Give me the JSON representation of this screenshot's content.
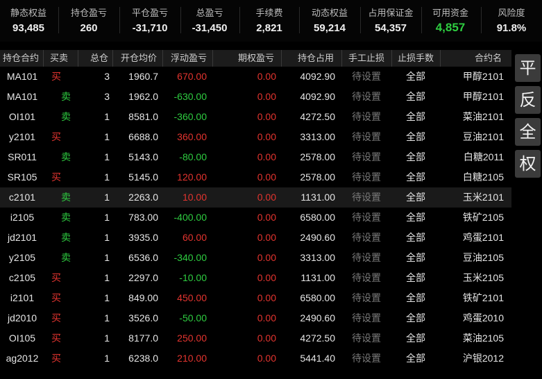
{
  "summary": [
    {
      "label": "静态权益",
      "value": "93,485"
    },
    {
      "label": "持仓盈亏",
      "value": "260"
    },
    {
      "label": "平仓盈亏",
      "value": "-31,710"
    },
    {
      "label": "总盈亏",
      "value": "-31,450"
    },
    {
      "label": "手续费",
      "value": "2,821"
    },
    {
      "label": "动态权益",
      "value": "59,214"
    },
    {
      "label": "占用保证金",
      "value": "54,357"
    },
    {
      "label": "可用资金",
      "value": "4,857"
    },
    {
      "label": "风险度",
      "value": "91.8%"
    }
  ],
  "columns": [
    "持仓合约",
    "买卖",
    "总仓",
    "开仓均价",
    "浮动盈亏",
    "期权盈亏",
    "持仓占用",
    "手工止损",
    "止损手数",
    "合约名"
  ],
  "rows": [
    {
      "contract": "MA101",
      "side": "买",
      "qty": "3",
      "avg": "1960.7",
      "pnl": "670.00",
      "opt": "0.00",
      "margin": "4092.90",
      "stop": "待设置",
      "stop_qty": "全部",
      "name": "甲醇2101"
    },
    {
      "contract": "MA101",
      "side": "卖",
      "qty": "3",
      "avg": "1962.0",
      "pnl": "-630.00",
      "opt": "0.00",
      "margin": "4092.90",
      "stop": "待设置",
      "stop_qty": "全部",
      "name": "甲醇2101"
    },
    {
      "contract": "OI101",
      "side": "卖",
      "qty": "1",
      "avg": "8581.0",
      "pnl": "-360.00",
      "opt": "0.00",
      "margin": "4272.50",
      "stop": "待设置",
      "stop_qty": "全部",
      "name": "菜油2101"
    },
    {
      "contract": "y2101",
      "side": "买",
      "qty": "1",
      "avg": "6688.0",
      "pnl": "360.00",
      "opt": "0.00",
      "margin": "3313.00",
      "stop": "待设置",
      "stop_qty": "全部",
      "name": "豆油2101"
    },
    {
      "contract": "SR011",
      "side": "卖",
      "qty": "1",
      "avg": "5143.0",
      "pnl": "-80.00",
      "opt": "0.00",
      "margin": "2578.00",
      "stop": "待设置",
      "stop_qty": "全部",
      "name": "白糖2011"
    },
    {
      "contract": "SR105",
      "side": "买",
      "qty": "1",
      "avg": "5145.0",
      "pnl": "120.00",
      "opt": "0.00",
      "margin": "2578.00",
      "stop": "待设置",
      "stop_qty": "全部",
      "name": "白糖2105"
    },
    {
      "contract": "c2101",
      "side": "卖",
      "qty": "1",
      "avg": "2263.0",
      "pnl": "10.00",
      "opt": "0.00",
      "margin": "1131.00",
      "stop": "待设置",
      "stop_qty": "全部",
      "name": "玉米2101"
    },
    {
      "contract": "i2105",
      "side": "卖",
      "qty": "1",
      "avg": "783.00",
      "pnl": "-400.00",
      "opt": "0.00",
      "margin": "6580.00",
      "stop": "待设置",
      "stop_qty": "全部",
      "name": "铁矿2105"
    },
    {
      "contract": "jd2101",
      "side": "卖",
      "qty": "1",
      "avg": "3935.0",
      "pnl": "60.00",
      "opt": "0.00",
      "margin": "2490.60",
      "stop": "待设置",
      "stop_qty": "全部",
      "name": "鸡蛋2101"
    },
    {
      "contract": "y2105",
      "side": "卖",
      "qty": "1",
      "avg": "6536.0",
      "pnl": "-340.00",
      "opt": "0.00",
      "margin": "3313.00",
      "stop": "待设置",
      "stop_qty": "全部",
      "name": "豆油2105"
    },
    {
      "contract": "c2105",
      "side": "买",
      "qty": "1",
      "avg": "2297.0",
      "pnl": "-10.00",
      "opt": "0.00",
      "margin": "1131.00",
      "stop": "待设置",
      "stop_qty": "全部",
      "name": "玉米2105"
    },
    {
      "contract": "i2101",
      "side": "买",
      "qty": "1",
      "avg": "849.00",
      "pnl": "450.00",
      "opt": "0.00",
      "margin": "6580.00",
      "stop": "待设置",
      "stop_qty": "全部",
      "name": "铁矿2101"
    },
    {
      "contract": "jd2010",
      "side": "买",
      "qty": "1",
      "avg": "3526.0",
      "pnl": "-50.00",
      "opt": "0.00",
      "margin": "2490.60",
      "stop": "待设置",
      "stop_qty": "全部",
      "name": "鸡蛋2010"
    },
    {
      "contract": "OI105",
      "side": "买",
      "qty": "1",
      "avg": "8177.0",
      "pnl": "250.00",
      "opt": "0.00",
      "margin": "4272.50",
      "stop": "待设置",
      "stop_qty": "全部",
      "name": "菜油2105"
    },
    {
      "contract": "ag2012",
      "side": "买",
      "qty": "1",
      "avg": "6238.0",
      "pnl": "210.00",
      "opt": "0.00",
      "margin": "5441.40",
      "stop": "待设置",
      "stop_qty": "全部",
      "name": "沪银2012"
    }
  ],
  "side_buttons": [
    {
      "label": "平"
    },
    {
      "label": "反"
    },
    {
      "label": "全"
    },
    {
      "label": "权"
    }
  ],
  "colors": {
    "up": "#e3342f",
    "down": "#2ecc40",
    "muted": "#7a7a7a",
    "highlight_row": "#1a1a1a"
  }
}
